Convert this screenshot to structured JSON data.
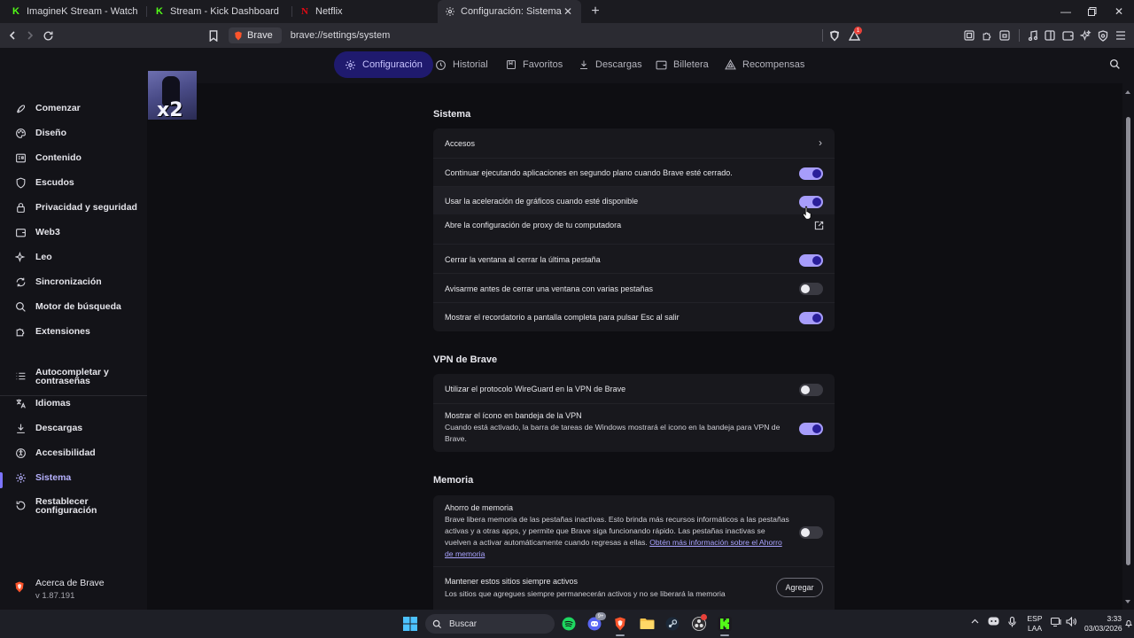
{
  "tabs": [
    {
      "title": "ImagineK Stream - Watch Live on",
      "favicon": "kick-icon",
      "color": "#53fc18"
    },
    {
      "title": "Stream - Kick Dashboard",
      "favicon": "kick-icon",
      "color": "#53fc18"
    },
    {
      "title": "Netflix",
      "favicon": "netflix-icon",
      "color": "#e50914"
    },
    {
      "title": "Configuración: Sistema",
      "favicon": "gear-icon",
      "active": true
    }
  ],
  "toolbar": {
    "site_chip": "Brave",
    "url": "brave://settings/system",
    "shields_badge": "1"
  },
  "topnav": [
    {
      "label": "Configuración",
      "icon": "gear-icon",
      "active": true
    },
    {
      "label": "Historial",
      "icon": "history-icon"
    },
    {
      "label": "Favoritos",
      "icon": "bookmarks-icon"
    },
    {
      "label": "Descargas",
      "icon": "download-icon"
    },
    {
      "label": "Billetera",
      "icon": "wallet-icon"
    },
    {
      "label": "Recompensas",
      "icon": "rewards-icon"
    }
  ],
  "sidebar": {
    "items": [
      {
        "label": "Comenzar",
        "icon": "rocket-icon"
      },
      {
        "label": "Diseño",
        "icon": "palette-icon"
      },
      {
        "label": "Contenido",
        "icon": "content-icon"
      },
      {
        "label": "Escudos",
        "icon": "shield-icon"
      },
      {
        "label": "Privacidad y seguridad",
        "icon": "lock-icon"
      },
      {
        "label": "Web3",
        "icon": "wallet-icon"
      },
      {
        "label": "Leo",
        "icon": "sparkle-icon"
      },
      {
        "label": "Sincronización",
        "icon": "sync-icon"
      },
      {
        "label": "Motor de búsqueda",
        "icon": "search-icon"
      },
      {
        "label": "Extensiones",
        "icon": "puzzle-icon"
      },
      {
        "label": "Autocompletar y contraseñas",
        "line1": "Autocompletar y",
        "line2": "contraseñas",
        "icon": "list-icon"
      },
      {
        "label": "Idiomas",
        "icon": "language-icon"
      },
      {
        "label": "Descargas",
        "icon": "download-icon"
      },
      {
        "label": "Accesibilidad",
        "icon": "accessibility-icon"
      },
      {
        "label": "Sistema",
        "icon": "gear-icon",
        "active": true
      },
      {
        "label": "Restablecer configuración",
        "line1": "Restablecer",
        "line2": "configuración",
        "icon": "reset-icon"
      }
    ],
    "about": {
      "name": "Acerca de Brave",
      "version": "v 1.87.191"
    }
  },
  "overlay": {
    "text": "x2"
  },
  "sections": {
    "sistema": {
      "title": "Sistema",
      "rows": [
        {
          "label": "Accesos",
          "type": "link"
        },
        {
          "label": "Continuar ejecutando aplicaciones en segundo plano cuando Brave esté cerrado.",
          "type": "toggle",
          "on": true
        },
        {
          "label": "Usar la aceleración de gráficos cuando esté disponible",
          "type": "toggle",
          "on": true
        },
        {
          "label": "Abre la configuración de proxy de tu computadora",
          "type": "external"
        },
        {
          "label": "Cerrar la ventana al cerrar la última pestaña",
          "type": "toggle",
          "on": true
        },
        {
          "label": "Avisarme antes de cerrar una ventana con varias pestañas",
          "type": "toggle",
          "on": false
        },
        {
          "label": "Mostrar el recordatorio a pantalla completa para pulsar Esc al salir",
          "type": "toggle",
          "on": true
        }
      ]
    },
    "vpn": {
      "title": "VPN de Brave",
      "rows": [
        {
          "label": "Utilizar el protocolo WireGuard en la VPN de Brave",
          "type": "toggle",
          "on": false
        },
        {
          "label": "Mostrar el ícono en bandeja de la VPN",
          "desc": "Cuando está activado, la barra de tareas de Windows mostrará el icono en la bandeja para VPN de Brave.",
          "type": "toggle",
          "on": true
        }
      ]
    },
    "memoria": {
      "title": "Memoria",
      "rows": [
        {
          "label": "Ahorro de memoria",
          "desc": "Brave libera memoria de las pestañas inactivas. Esto brinda más recursos informáticos a las pestañas activas y a otras apps, y permite que Brave siga funcionando rápido. Las pestañas inactivas se vuelven a activar automáticamente cuando regresas a ellas.",
          "link": "Obtén más información sobre el Ahorro de memoria",
          "type": "toggle",
          "on": false
        },
        {
          "label": "Mantener estos sitios siempre activos",
          "desc": "Los sitios que agregues siempre permanecerán activos y no se liberará la memoria",
          "button": "Agregar",
          "type": "button"
        }
      ]
    }
  },
  "taskbar": {
    "search_placeholder": "Buscar",
    "lang_line1": "ESP",
    "lang_line2": "LAA",
    "time": "3:33",
    "date": "03/03/2026",
    "discord_badge": "9+"
  },
  "colors": {
    "accent": "#a79dfb",
    "nav_active_bg": "#1f1a6e",
    "toggle_knob_on": "#2a1f9a"
  }
}
